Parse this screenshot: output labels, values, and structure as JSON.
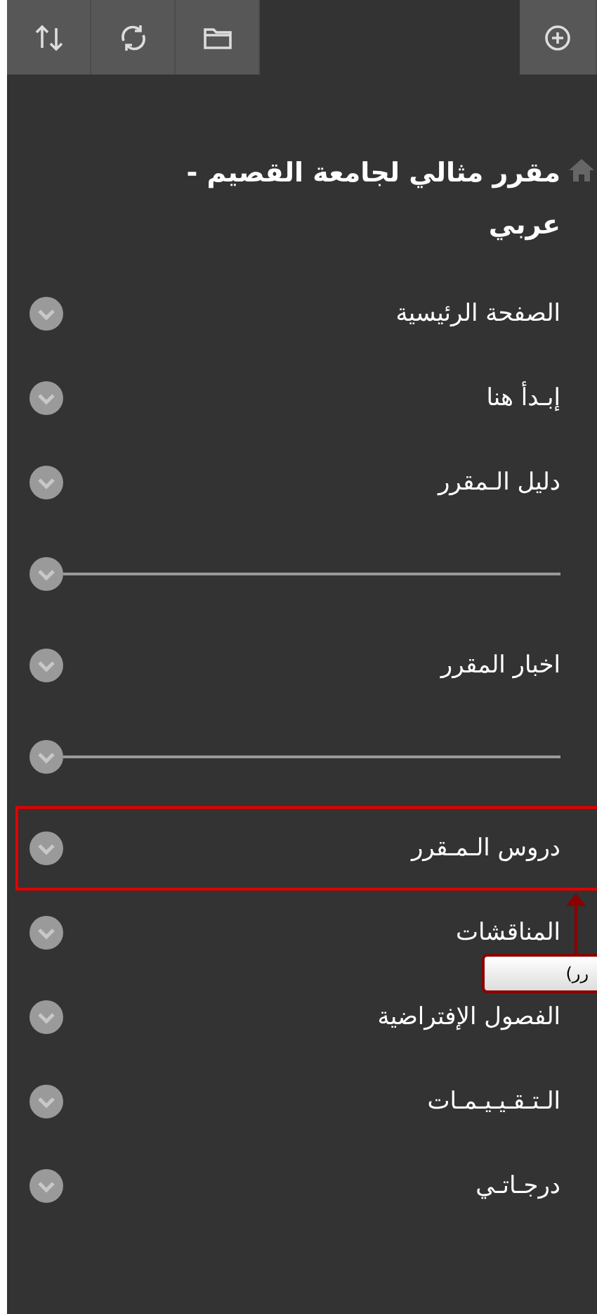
{
  "toolbar": {
    "buttons": [
      {
        "kind": "sort"
      },
      {
        "kind": "refresh"
      },
      {
        "kind": "folder"
      }
    ],
    "add_button": {
      "kind": "add"
    }
  },
  "course_title": "مقرر مثالي لجامعة القصيم - عربي",
  "menu": [
    {
      "kind": "link",
      "label": "الصفحة الرئيسية",
      "selected": false
    },
    {
      "kind": "link",
      "label": "إبـدأ هنا",
      "selected": false
    },
    {
      "kind": "link",
      "label": "دليل الـمقرر",
      "selected": false
    },
    {
      "kind": "divider"
    },
    {
      "kind": "link",
      "label": "اخبار المقرر",
      "selected": false
    },
    {
      "kind": "divider"
    },
    {
      "kind": "link",
      "label": "دروس الـمـقرر",
      "selected": true
    },
    {
      "kind": "link",
      "label": "المناقشات",
      "selected": false
    },
    {
      "kind": "link",
      "label": "الفصول الإفتراضية",
      "selected": false
    },
    {
      "kind": "link",
      "label": "الـتـقـيـيـمـات",
      "selected": false
    },
    {
      "kind": "link",
      "label": "درجـاتـي",
      "selected": false
    }
  ],
  "callout": {
    "text": "رر)"
  }
}
